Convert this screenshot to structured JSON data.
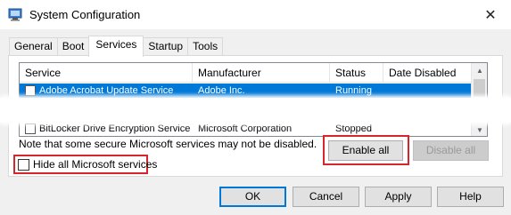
{
  "window": {
    "title": "System Configuration",
    "close_glyph": "✕"
  },
  "tabs": [
    {
      "label": "General",
      "active": false
    },
    {
      "label": "Boot",
      "active": false
    },
    {
      "label": "Services",
      "active": true
    },
    {
      "label": "Startup",
      "active": false
    },
    {
      "label": "Tools",
      "active": false
    }
  ],
  "services": {
    "columns": [
      "Service",
      "Manufacturer",
      "Status",
      "Date Disabled"
    ],
    "rows": [
      {
        "service": "Adobe Acrobat Update Service",
        "manufacturer": "Adobe Inc.",
        "status": "Running",
        "date_disabled": "",
        "selected": true
      },
      {
        "service": "BitLocker Drive Encryption Service",
        "manufacturer": "Microsoft Corporation",
        "status": "Stopped",
        "date_disabled": "",
        "selected": false
      }
    ]
  },
  "note": "Note that some secure Microsoft services may not be disabled.",
  "buttons": {
    "enable_all": "Enable all",
    "disable_all": "Disable all",
    "ok": "OK",
    "cancel": "Cancel",
    "apply": "Apply",
    "help": "Help"
  },
  "hide_microsoft": {
    "label": "Hide all Microsoft services",
    "checked": false
  },
  "colors": {
    "highlight_box": "#d6262b",
    "selection": "#0078d7"
  }
}
